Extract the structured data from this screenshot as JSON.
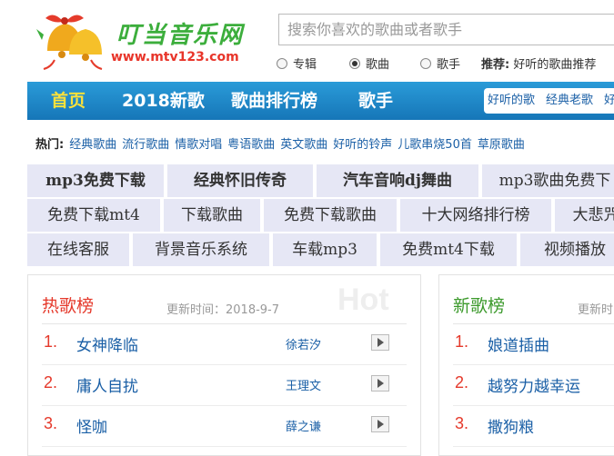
{
  "header": {
    "logo_title": "叮当音乐网",
    "logo_url": "www.mtv123.com",
    "search_placeholder": "搜索你喜欢的歌曲或者歌手",
    "radios": [
      {
        "label": "专辑",
        "checked": false
      },
      {
        "label": "歌曲",
        "checked": true
      },
      {
        "label": "歌手",
        "checked": false
      }
    ],
    "recommend_label": "推荐:",
    "recommend_link": "好听的歌曲推荐"
  },
  "nav": {
    "items": [
      "首页",
      "2018新歌",
      "歌曲排行榜",
      "歌手"
    ],
    "quick_links": [
      "好听的歌",
      "经典老歌",
      "好"
    ]
  },
  "hot": {
    "label": "热门:",
    "links": [
      "经典歌曲",
      "流行歌曲",
      "情歌对唱",
      "粤语歌曲",
      "英文歌曲",
      "好听的铃声",
      "儿歌串烧50首",
      "草原歌曲"
    ]
  },
  "tags": [
    [
      "mp3免费下载",
      "经典怀旧传奇",
      "汽车音响dj舞曲",
      "mp3歌曲免费下"
    ],
    [
      "免费下载mt4",
      "下载歌曲",
      "免费下载歌曲",
      "十大网络排行榜",
      "大悲咒"
    ],
    [
      "在线客服",
      "背景音乐系统",
      "车载mp3",
      "免费mt4下载",
      "视频播放"
    ]
  ],
  "hot_chart": {
    "title": "热歌榜",
    "update": "更新时间：2018-9-7",
    "watermark": "Hot",
    "songs": [
      {
        "num": "1.",
        "title": "女神降临",
        "artist": "徐若汐"
      },
      {
        "num": "2.",
        "title": "庸人自扰",
        "artist": "王理文"
      },
      {
        "num": "3.",
        "title": "怪咖",
        "artist": "薛之谦"
      }
    ]
  },
  "new_chart": {
    "title": "新歌榜",
    "update": "更新时",
    "songs": [
      {
        "num": "1.",
        "title": "娘道插曲"
      },
      {
        "num": "2.",
        "title": "越努力越幸运"
      },
      {
        "num": "3.",
        "title": "撒狗粮"
      }
    ]
  },
  "colors": {
    "nav_blue": "#1d86c5",
    "nav_active": "#ffe23a",
    "link_blue": "#1a5fa6",
    "rank_red": "#e5392b",
    "logo_green": "#3cae3c",
    "tag_bg": "#e6e7f5"
  }
}
